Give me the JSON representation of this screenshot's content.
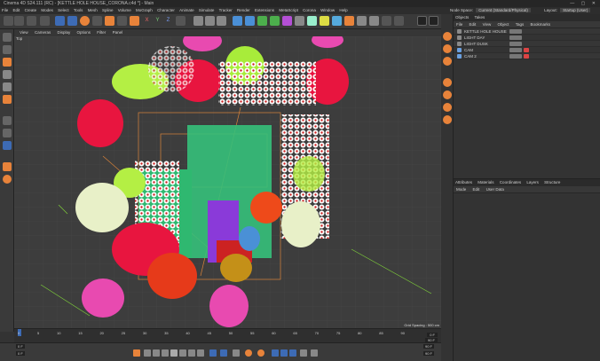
{
  "window": {
    "title": "Cinema 4D S24.111 (RC) - [KETTLE HOLE HOUSE_CORONA.c4d *] - Main",
    "controls": "— ▢ ✕"
  },
  "menu": [
    "File",
    "Edit",
    "Create",
    "Modes",
    "Select",
    "Tools",
    "Mesh",
    "Spline",
    "Volume",
    "MoGraph",
    "Character",
    "Animate",
    "Simulate",
    "Tracker",
    "Render",
    "Extensions",
    "MetaScript",
    "Corona",
    "Window",
    "Help"
  ],
  "node_space": {
    "label": "Node Space:",
    "value": "Current (Standard/Physical)",
    "layout_label": "Layout:",
    "layout_value": "Startup (User)"
  },
  "toolbar": {
    "x_label": "X",
    "y_label": "Y",
    "z_label": "Z"
  },
  "viewport_menu": [
    "View",
    "Cameras",
    "Display",
    "Options",
    "Filter",
    "Panel"
  ],
  "viewport": {
    "camera_label": "Top",
    "grid_spacing": "Grid Spacing : 500 cm"
  },
  "timeline": {
    "ticks": [
      "0",
      "5",
      "10",
      "15",
      "20",
      "25",
      "30",
      "35",
      "40",
      "45",
      "50",
      "55",
      "60",
      "65",
      "70",
      "75",
      "80",
      "85",
      "90"
    ],
    "current_frame": "0 F",
    "end_frame": "90 F"
  },
  "transport": {
    "start": "0 F",
    "start2": "0 F",
    "end": "90 F",
    "end2": "90 F"
  },
  "objects_panel": {
    "tabs": [
      "Objects",
      "Takes"
    ],
    "menu": [
      "File",
      "Edit",
      "View",
      "Object",
      "Tags",
      "Bookmarks"
    ],
    "rows": [
      "KETTLE HOLE HOUSE",
      "LIGHT DAY",
      "LIGHT DUSK",
      "CAM",
      "CAM 2"
    ]
  },
  "attributes_panel": {
    "tabs": [
      "Attributes",
      "Materials",
      "Coordinates",
      "Layers",
      "Structure"
    ],
    "menu": [
      "Mode",
      "Edit",
      "User Data"
    ]
  },
  "colors": {
    "accent": "#e8833a",
    "selection_blue": "#3d6bb5",
    "viewport_bg": "#3d3d3d"
  }
}
